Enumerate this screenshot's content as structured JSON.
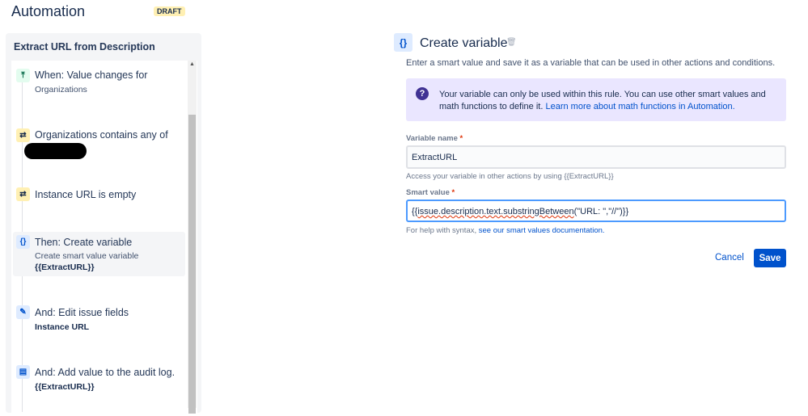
{
  "header": {
    "title": "Automation",
    "badge": "DRAFT"
  },
  "rule": {
    "name": "Extract URL from Description",
    "items": [
      {
        "icon": "trigger-icon",
        "title": "When: Value changes for",
        "subtitle": "Organizations"
      },
      {
        "icon": "condition-icon",
        "title": "Organizations contains any of"
      },
      {
        "icon": "condition-icon",
        "title": "Instance URL is empty"
      },
      {
        "icon": "variable-icon",
        "title": "Then: Create variable",
        "subtitle": "Create smart value variable",
        "detail": "{{ExtractURL}}"
      },
      {
        "icon": "pencil-icon",
        "title": "And: Edit issue fields",
        "detail": "Instance URL"
      },
      {
        "icon": "audit-log-icon",
        "title": "And: Add value to the audit log.",
        "detail": "{{ExtractURL}}"
      }
    ]
  },
  "editor": {
    "title": "Create variable",
    "description": "Enter a smart value and save it as a variable that can be used in other actions and conditions.",
    "info": {
      "text": "Your variable can only be used within this rule. You can use other smart values and math functions to define it.",
      "link": "Learn more about math functions in Automation."
    },
    "variable_name": {
      "label": "Variable name",
      "value": "ExtractURL",
      "help": "Access your variable in other actions by using {{ExtractURL}}"
    },
    "smart_value": {
      "label": "Smart value",
      "value_prefix": "{{",
      "value_squiggle": "issue.description.text.substringBetween",
      "value_suffix": "(\"URL: \",\"//\")}}",
      "help_prefix": "For help with syntax,",
      "help_link": "see our smart values documentation."
    },
    "cancel": "Cancel",
    "save": "Save",
    "required_mark": "*"
  }
}
